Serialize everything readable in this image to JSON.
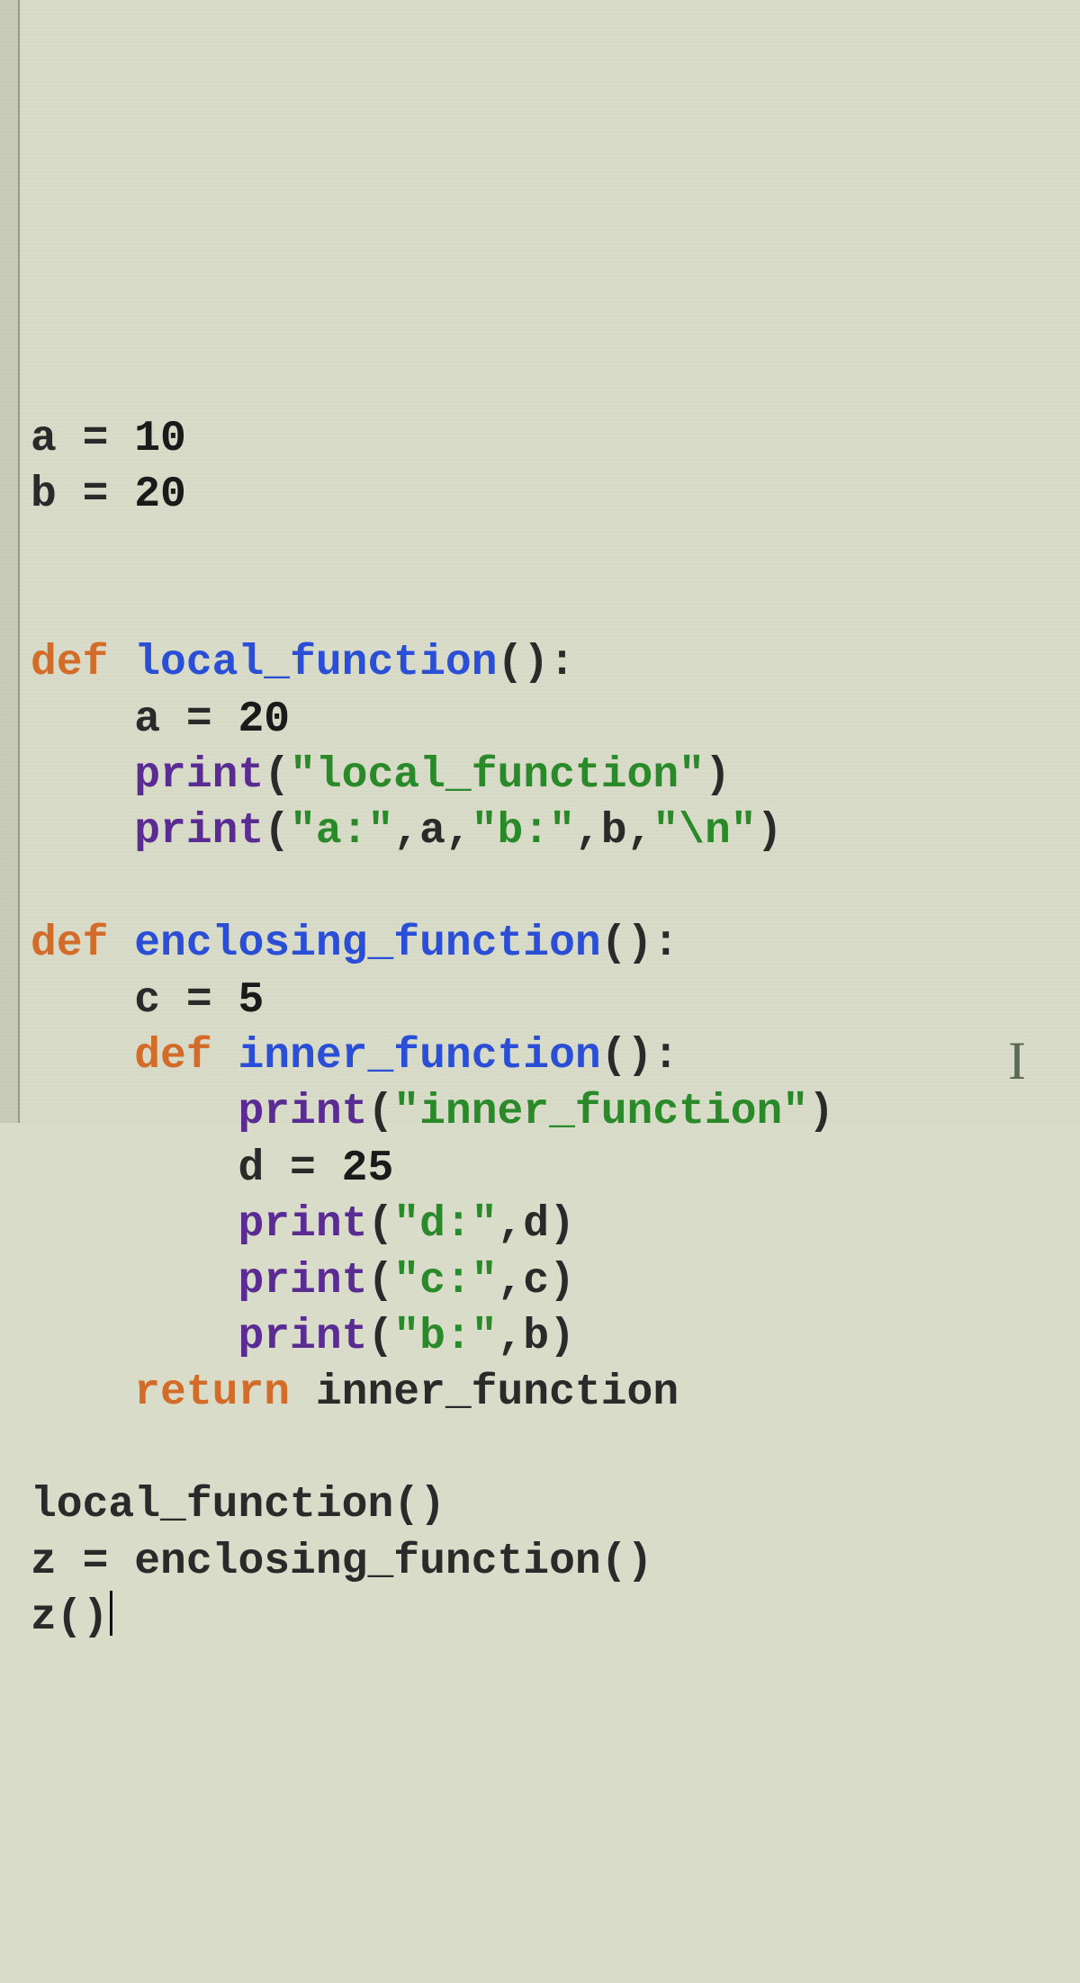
{
  "code": {
    "tokens": [
      [
        {
          "t": "a ",
          "c": ""
        },
        {
          "t": "=",
          "c": ""
        },
        {
          "t": " 10",
          "c": "num"
        }
      ],
      [
        {
          "t": "b ",
          "c": ""
        },
        {
          "t": "=",
          "c": ""
        },
        {
          "t": " 20",
          "c": "num"
        }
      ],
      [],
      [],
      [
        {
          "t": "def",
          "c": "kw"
        },
        {
          "t": " ",
          "c": ""
        },
        {
          "t": "local_function",
          "c": "fn"
        },
        {
          "t": "():",
          "c": ""
        }
      ],
      [
        {
          "t": "    a ",
          "c": ""
        },
        {
          "t": "=",
          "c": ""
        },
        {
          "t": " 20",
          "c": "num"
        }
      ],
      [
        {
          "t": "    ",
          "c": ""
        },
        {
          "t": "print",
          "c": "call"
        },
        {
          "t": "(",
          "c": ""
        },
        {
          "t": "\"local_function\"",
          "c": "str"
        },
        {
          "t": ")",
          "c": ""
        }
      ],
      [
        {
          "t": "    ",
          "c": ""
        },
        {
          "t": "print",
          "c": "call"
        },
        {
          "t": "(",
          "c": ""
        },
        {
          "t": "\"a:\"",
          "c": "str"
        },
        {
          "t": ",a,",
          "c": ""
        },
        {
          "t": "\"b:\"",
          "c": "str"
        },
        {
          "t": ",b,",
          "c": ""
        },
        {
          "t": "\"\\n\"",
          "c": "str"
        },
        {
          "t": ")",
          "c": ""
        }
      ],
      [],
      [
        {
          "t": "def",
          "c": "kw"
        },
        {
          "t": " ",
          "c": ""
        },
        {
          "t": "enclosing_function",
          "c": "fn"
        },
        {
          "t": "():",
          "c": ""
        }
      ],
      [
        {
          "t": "    c ",
          "c": ""
        },
        {
          "t": "=",
          "c": ""
        },
        {
          "t": " 5",
          "c": "num"
        }
      ],
      [
        {
          "t": "    ",
          "c": ""
        },
        {
          "t": "def",
          "c": "kw"
        },
        {
          "t": " ",
          "c": ""
        },
        {
          "t": "inner_function",
          "c": "fn"
        },
        {
          "t": "():",
          "c": ""
        }
      ],
      [
        {
          "t": "        ",
          "c": ""
        },
        {
          "t": "print",
          "c": "call"
        },
        {
          "t": "(",
          "c": ""
        },
        {
          "t": "\"inner_function\"",
          "c": "str"
        },
        {
          "t": ")",
          "c": ""
        }
      ],
      [
        {
          "t": "        d ",
          "c": ""
        },
        {
          "t": "=",
          "c": ""
        },
        {
          "t": " 25",
          "c": "num"
        }
      ],
      [
        {
          "t": "        ",
          "c": ""
        },
        {
          "t": "print",
          "c": "call"
        },
        {
          "t": "(",
          "c": ""
        },
        {
          "t": "\"d:\"",
          "c": "str"
        },
        {
          "t": ",d)",
          "c": ""
        }
      ],
      [
        {
          "t": "        ",
          "c": ""
        },
        {
          "t": "print",
          "c": "call"
        },
        {
          "t": "(",
          "c": ""
        },
        {
          "t": "\"c:\"",
          "c": "str"
        },
        {
          "t": ",c)",
          "c": ""
        }
      ],
      [
        {
          "t": "        ",
          "c": ""
        },
        {
          "t": "print",
          "c": "call"
        },
        {
          "t": "(",
          "c": ""
        },
        {
          "t": "\"b:\"",
          "c": "str"
        },
        {
          "t": ",b)",
          "c": ""
        }
      ],
      [
        {
          "t": "    ",
          "c": ""
        },
        {
          "t": "return",
          "c": "kw"
        },
        {
          "t": " inner_function",
          "c": ""
        }
      ],
      [],
      [
        {
          "t": "local_function()",
          "c": ""
        }
      ],
      [
        {
          "t": "z ",
          "c": ""
        },
        {
          "t": "=",
          "c": ""
        },
        {
          "t": " enclosing_function()",
          "c": ""
        }
      ],
      [
        {
          "t": "z()",
          "c": ""
        },
        {
          "t": "|",
          "c": "caret-marker"
        }
      ]
    ]
  },
  "cursor": {
    "line": 22,
    "col": 4
  }
}
